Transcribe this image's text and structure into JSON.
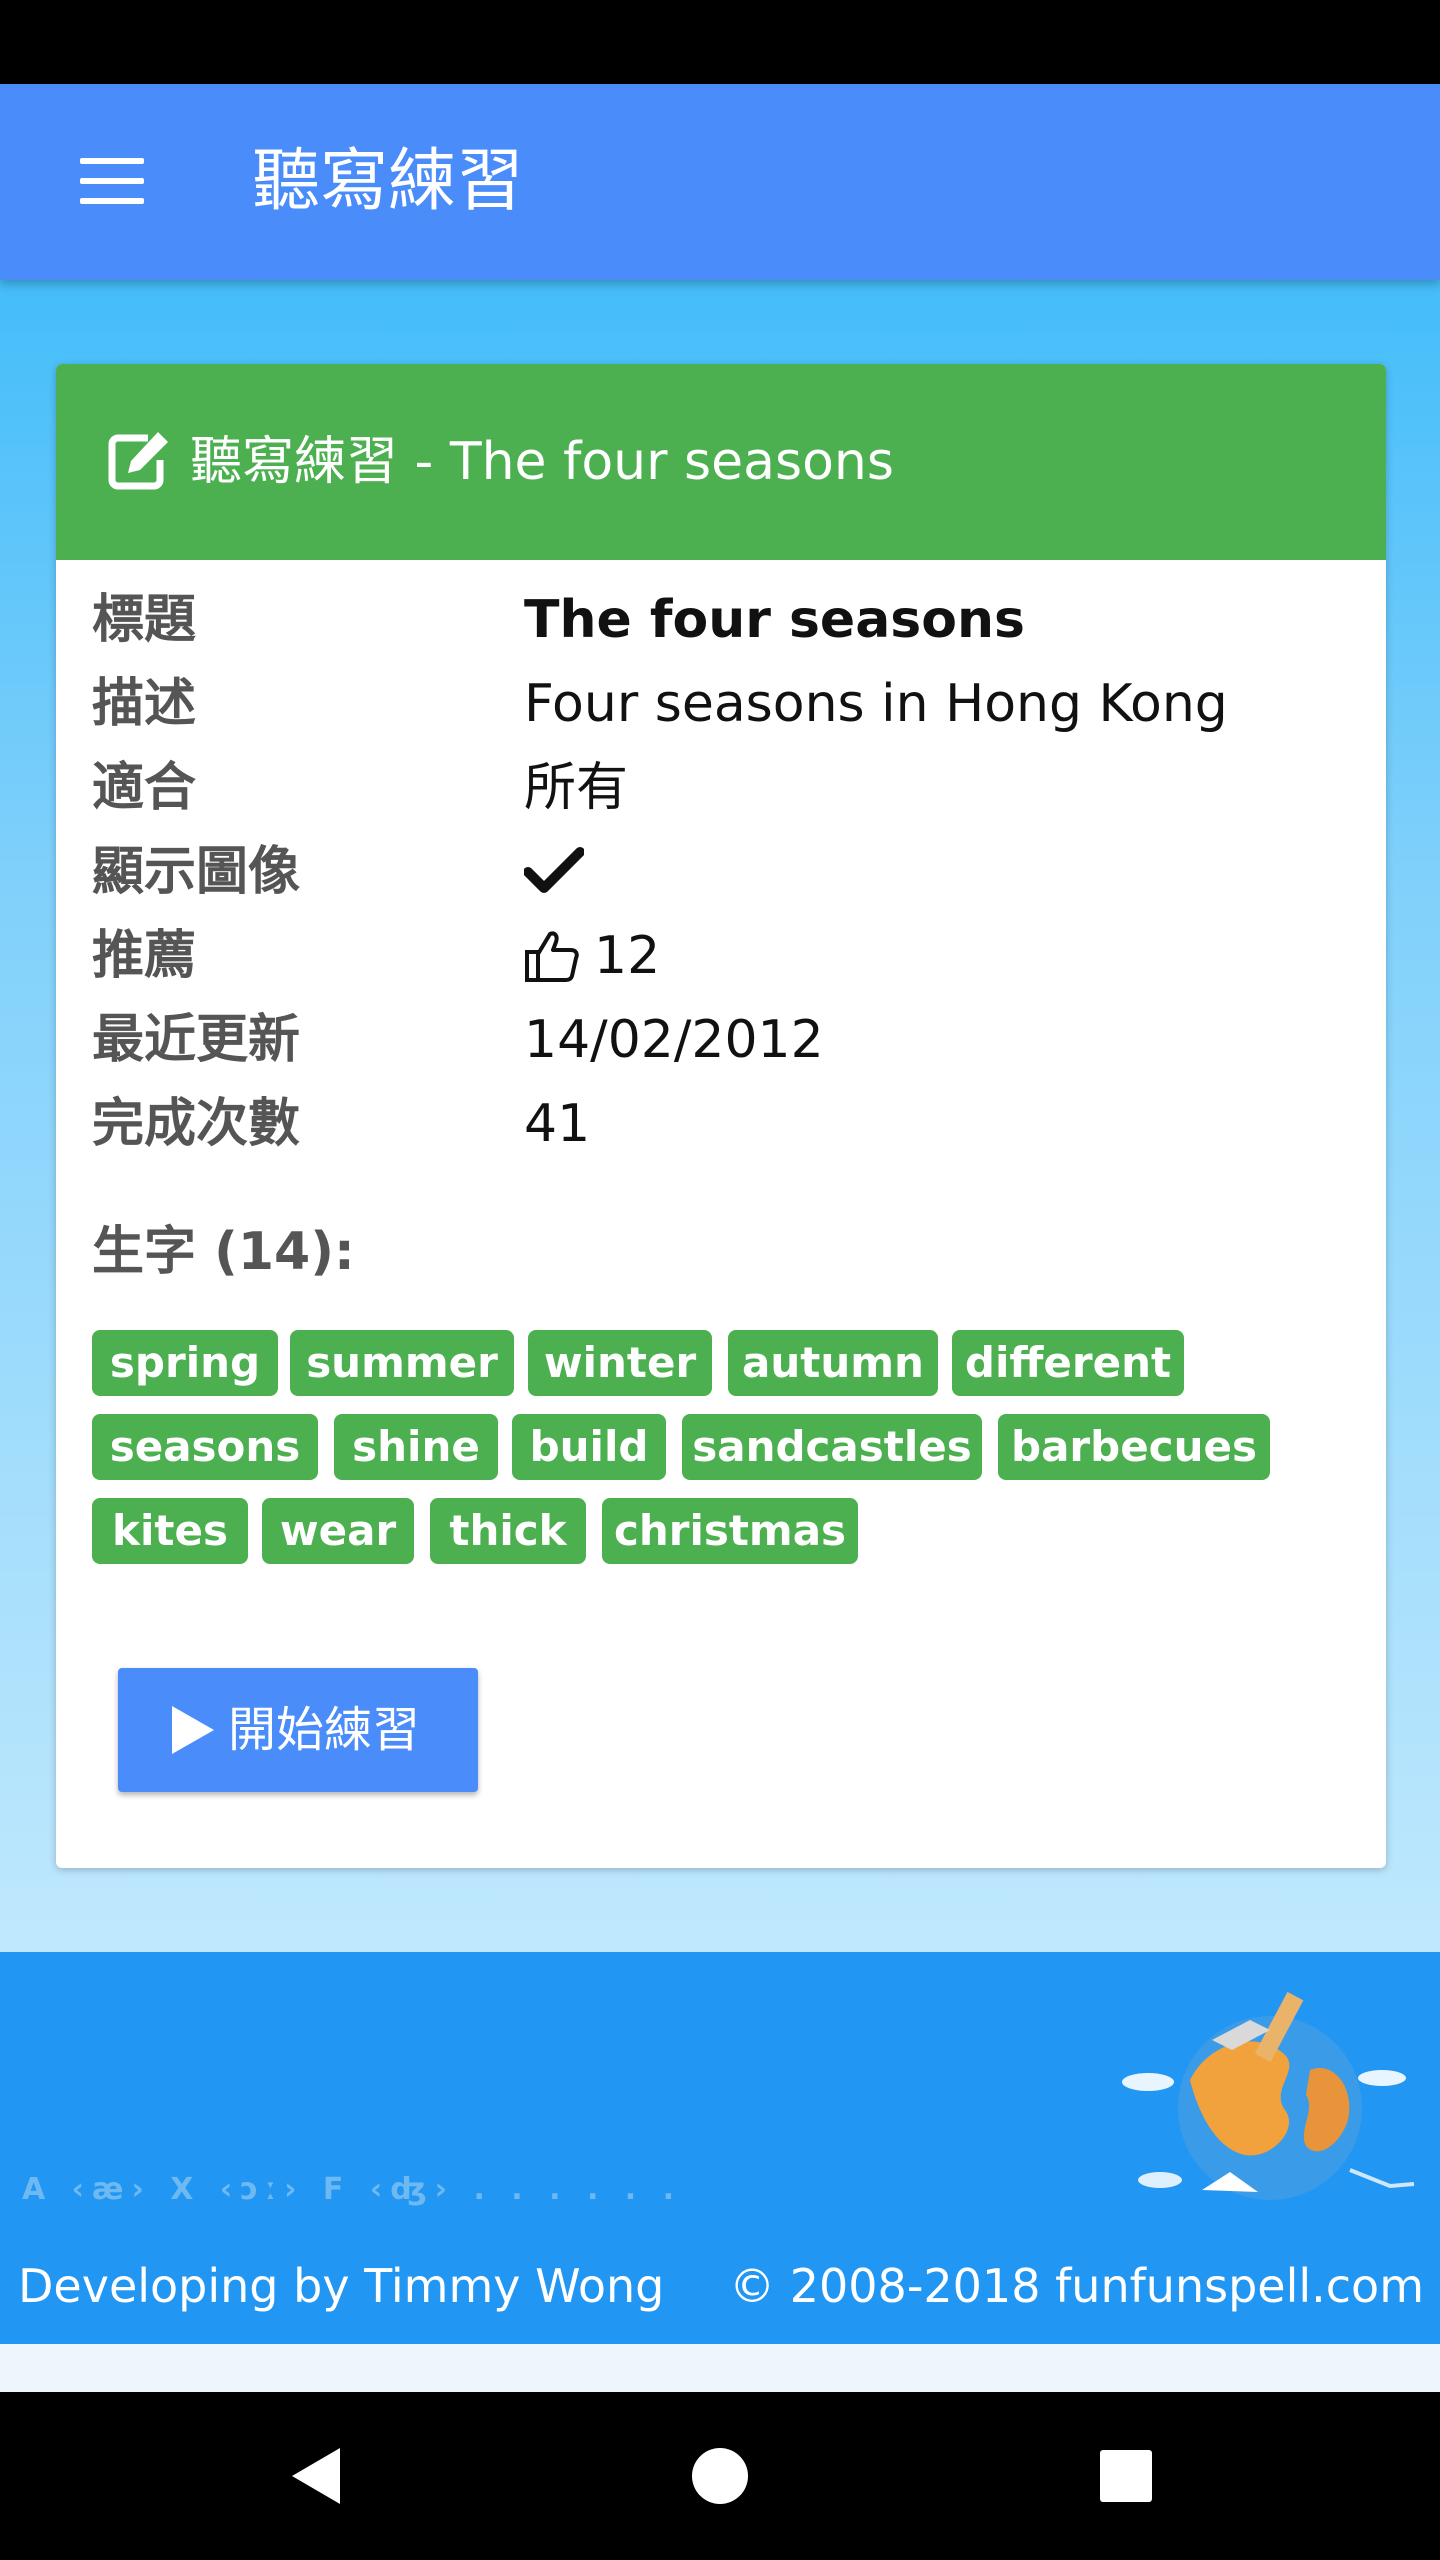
{
  "app_bar": {
    "title": "聽寫練習",
    "menu_icon": "hamburger-menu-icon"
  },
  "card": {
    "header_icon": "edit-icon",
    "header_title": "聽寫練習 - The four seasons",
    "rows": {
      "title": {
        "label": "標題",
        "value": "The four seasons"
      },
      "description": {
        "label": "描述",
        "value": "Four seasons in Hong Kong"
      },
      "suitable": {
        "label": "適合",
        "value": "所有"
      },
      "show_images": {
        "label": "顯示圖像",
        "value_icon": "check-icon"
      },
      "recommend": {
        "label": "推薦",
        "value_icon": "thumbs-up-icon",
        "value": "12"
      },
      "last_updated": {
        "label": "最近更新",
        "value": "14/02/2012"
      },
      "completed": {
        "label": "完成次數",
        "value": "41"
      }
    },
    "words_heading": "生字 (14):",
    "words": [
      "spring",
      "summer",
      "winter",
      "autumn",
      "different",
      "seasons",
      "shine",
      "build",
      "sandcastles",
      "barbecues",
      "kites",
      "wear",
      "thick",
      "christmas"
    ],
    "start_button": {
      "icon": "play-icon",
      "label": "開始練習"
    }
  },
  "footer": {
    "phonetic_strip": "A ‹æ› X ‹ɔː› F ‹ʤ› . . . . . .",
    "left_text": "Developing by Timmy Wong",
    "right_text": "© 2008-2018 funfunspell.com",
    "image": "globe-illustration"
  },
  "nav_bar": {
    "back_icon": "back-triangle-icon",
    "home_icon": "home-circle-icon",
    "recents_icon": "recents-square-icon"
  },
  "colors": {
    "app_bar": "#4a8cf9",
    "card_header": "#4caf50",
    "tag": "#4caf50",
    "button": "#4a8cf9",
    "footer": "#2196f3"
  }
}
